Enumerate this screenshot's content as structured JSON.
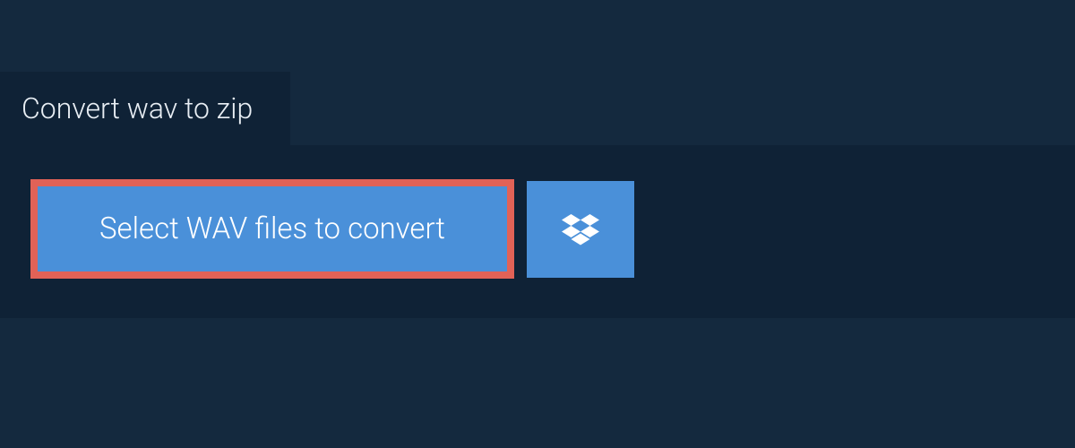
{
  "tab": {
    "title": "Convert wav to zip"
  },
  "actions": {
    "select_label": "Select WAV files to convert"
  },
  "colors": {
    "page_bg": "#14293e",
    "panel_bg": "#0f2236",
    "button_bg": "#4a90d9",
    "highlight_border": "#e16257",
    "text_light": "#ffffff"
  }
}
